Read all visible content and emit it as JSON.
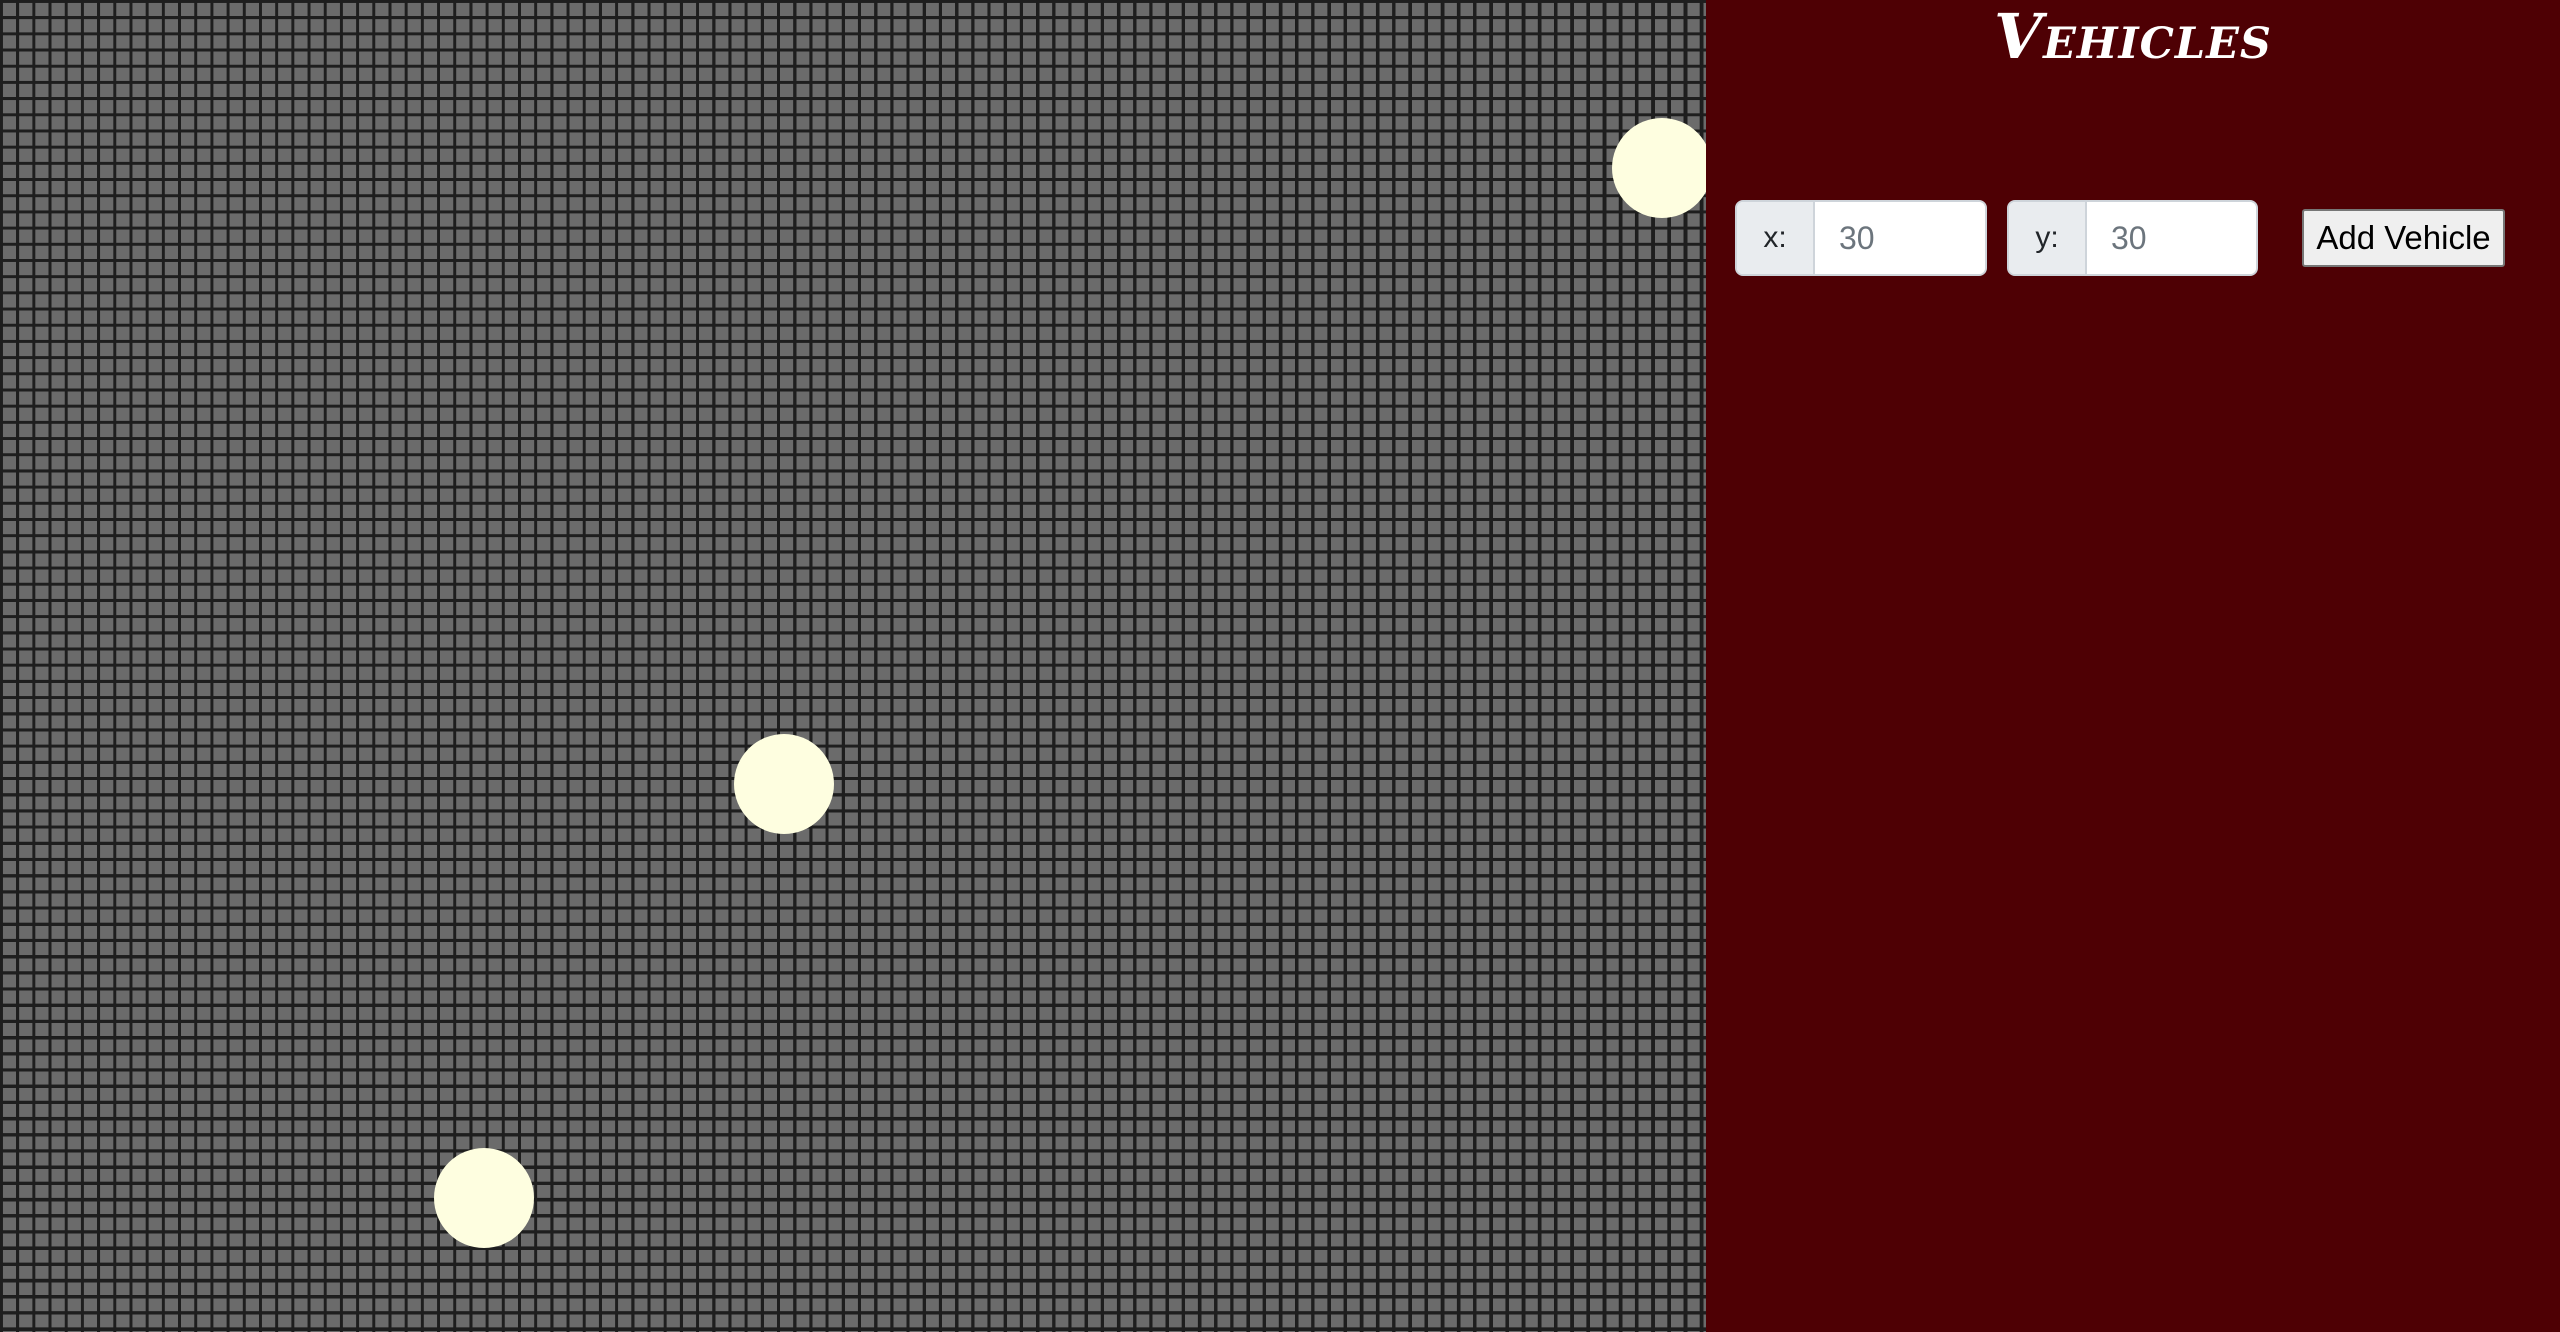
{
  "colors": {
    "grid_background": "#6b6b6b",
    "grid_lines": "#1e1e1e",
    "vehicle": "#fefee0",
    "panel_background": "#4e0004",
    "title_text": "#ffffff"
  },
  "panel": {
    "title": "Vehicles",
    "x_label": "x:",
    "x_placeholder": "30",
    "y_label": "y:",
    "y_placeholder": "30",
    "add_button_label": "Add Vehicle"
  },
  "vehicles": [
    {
      "id": "vehicle-1",
      "icon": "circle"
    },
    {
      "id": "vehicle-2",
      "icon": "circle"
    },
    {
      "id": "vehicle-3",
      "icon": "circle"
    }
  ]
}
